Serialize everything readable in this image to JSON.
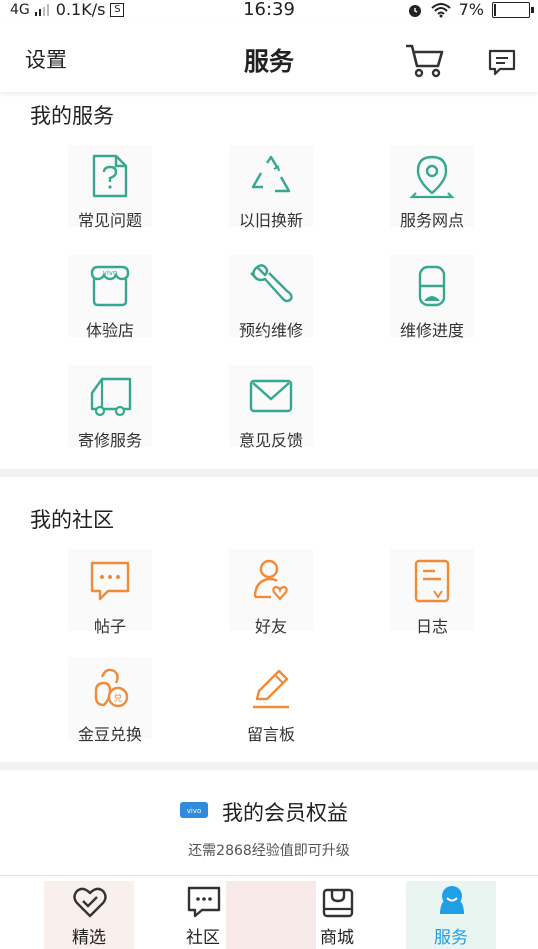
{
  "status_bar": {
    "network": "4G",
    "speed": "0.1K/s",
    "sim_icon": "S",
    "time": "16:39",
    "battery": "7%",
    "battery_level": 0.07
  },
  "header": {
    "settings_label": "设置",
    "title": "服务"
  },
  "my_services": {
    "title": "我的服务",
    "items": [
      {
        "label": "常见问题",
        "icon": "question-doc-icon"
      },
      {
        "label": "以旧换新",
        "icon": "recycle-icon"
      },
      {
        "label": "服务网点",
        "icon": "location-pin-icon"
      },
      {
        "label": "体验店",
        "icon": "vivo-store-icon"
      },
      {
        "label": "预约维修",
        "icon": "wrench-icon"
      },
      {
        "label": "维修进度",
        "icon": "hourglass-icon"
      },
      {
        "label": "寄修服务",
        "icon": "truck-icon"
      },
      {
        "label": "意见反馈",
        "icon": "envelope-icon"
      }
    ]
  },
  "my_community": {
    "title": "我的社区",
    "items": [
      {
        "label": "帖子",
        "icon": "chat-bubble-icon"
      },
      {
        "label": "好友",
        "icon": "friend-heart-icon"
      },
      {
        "label": "日志",
        "icon": "log-doc-icon"
      },
      {
        "label": "金豆兑换",
        "icon": "bean-exchange-icon"
      },
      {
        "label": "留言板",
        "icon": "pencil-icon"
      }
    ]
  },
  "member": {
    "badge": "vivo",
    "title": "我的会员权益",
    "subtitle": "还需2868经验值即可升级"
  },
  "tabbar": {
    "items": [
      {
        "label": "精选",
        "icon": "heart-check-icon"
      },
      {
        "label": "社区",
        "icon": "message-icon"
      },
      {
        "label": "商城",
        "icon": "shopping-bag-icon"
      },
      {
        "label": "服务",
        "icon": "service-face-icon"
      }
    ],
    "active_color": "#1e9fe6"
  },
  "colors": {
    "service_teal": "#35a88f",
    "community_orange": "#f08b3a"
  }
}
